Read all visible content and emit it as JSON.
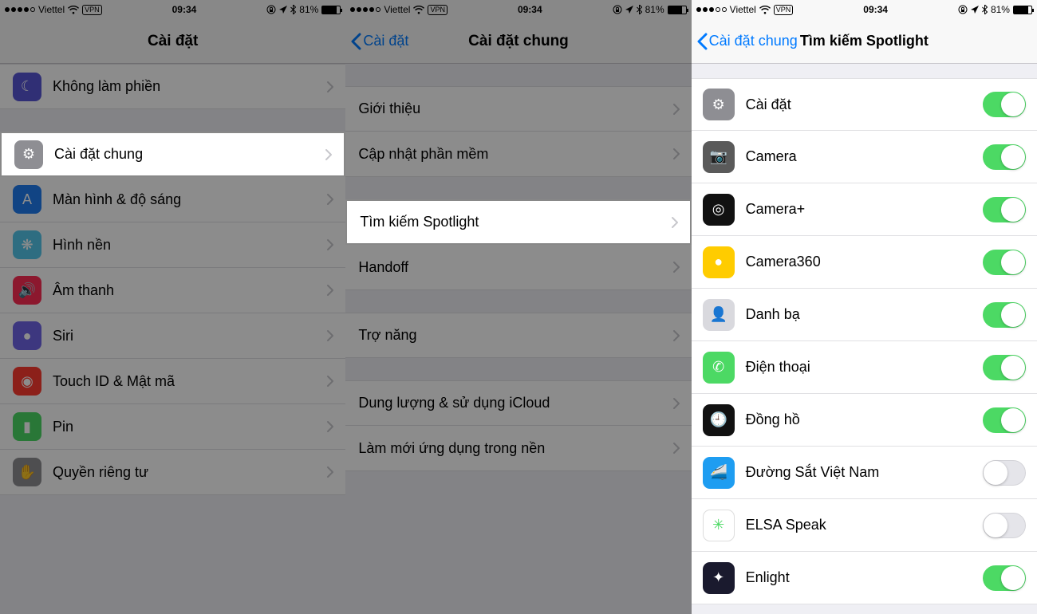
{
  "status": {
    "carrier": "Viettel",
    "vpn": "VPN",
    "time": "09:34",
    "battery_pct": "81%",
    "signal_filled": 4,
    "signal_total": 5
  },
  "screen1": {
    "title": "Cài đặt",
    "items": [
      {
        "label": "Không làm phiền",
        "icon_bg": "#5856d6",
        "glyph": "☾"
      },
      {
        "label": "Cài đặt chung",
        "icon_bg": "#8e8e93",
        "glyph": "⚙"
      },
      {
        "label": "Màn hình & độ sáng",
        "icon_bg": "#1f7cf1",
        "glyph": "A"
      },
      {
        "label": "Hình nền",
        "icon_bg": "#54c7ec",
        "glyph": "❋"
      },
      {
        "label": "Âm thanh",
        "icon_bg": "#ff2d55",
        "glyph": "🔊"
      },
      {
        "label": "Siri",
        "icon_bg": "#6f64e8",
        "glyph": "●"
      },
      {
        "label": "Touch ID & Mật mã",
        "icon_bg": "#ff3b30",
        "glyph": "◉"
      },
      {
        "label": "Pin",
        "icon_bg": "#4cd964",
        "glyph": "▮"
      },
      {
        "label": "Quyền riêng tư",
        "icon_bg": "#8e8e93",
        "glyph": "✋"
      }
    ],
    "highlight_index": 1
  },
  "screen2": {
    "back": "Cài đặt",
    "title": "Cài đặt chung",
    "groups": [
      [
        {
          "label": "Giới thiệu"
        },
        {
          "label": "Cập nhật phần mềm"
        }
      ],
      [
        {
          "label": "Tìm kiếm Spotlight"
        },
        {
          "label": "Handoff"
        }
      ],
      [
        {
          "label": "Trợ năng"
        }
      ],
      [
        {
          "label": "Dung lượng & sử dụng iCloud"
        },
        {
          "label": "Làm mới ứng dụng trong nền"
        }
      ]
    ],
    "highlight": "Tìm kiếm Spotlight"
  },
  "screen3": {
    "back": "Cài đặt chung",
    "title": "Tìm kiếm Spotlight",
    "items": [
      {
        "label": "Cài đặt",
        "on": true,
        "icon_bg": "#8e8e93",
        "glyph": "⚙"
      },
      {
        "label": "Camera",
        "on": true,
        "icon_bg": "#5a5a5a",
        "glyph": "📷"
      },
      {
        "label": "Camera+",
        "on": true,
        "icon_bg": "#111111",
        "glyph": "◎"
      },
      {
        "label": "Camera360",
        "on": true,
        "icon_bg": "#ffcc00",
        "glyph": "●"
      },
      {
        "label": "Danh bạ",
        "on": true,
        "icon_bg": "#d9d9de",
        "glyph": "👤"
      },
      {
        "label": "Điện thoại",
        "on": true,
        "icon_bg": "#4cd964",
        "glyph": "✆"
      },
      {
        "label": "Đồng hồ",
        "on": true,
        "icon_bg": "#111111",
        "glyph": "🕘"
      },
      {
        "label": "Đường Sắt Việt Nam",
        "on": false,
        "icon_bg": "#1e9df1",
        "glyph": "🚄"
      },
      {
        "label": "ELSA Speak",
        "on": false,
        "icon_bg": "#ffffff",
        "glyph": "✳",
        "glyph_color": "#4cd964"
      },
      {
        "label": "Enlight",
        "on": true,
        "icon_bg": "#1a1a2e",
        "glyph": "✦"
      }
    ]
  }
}
